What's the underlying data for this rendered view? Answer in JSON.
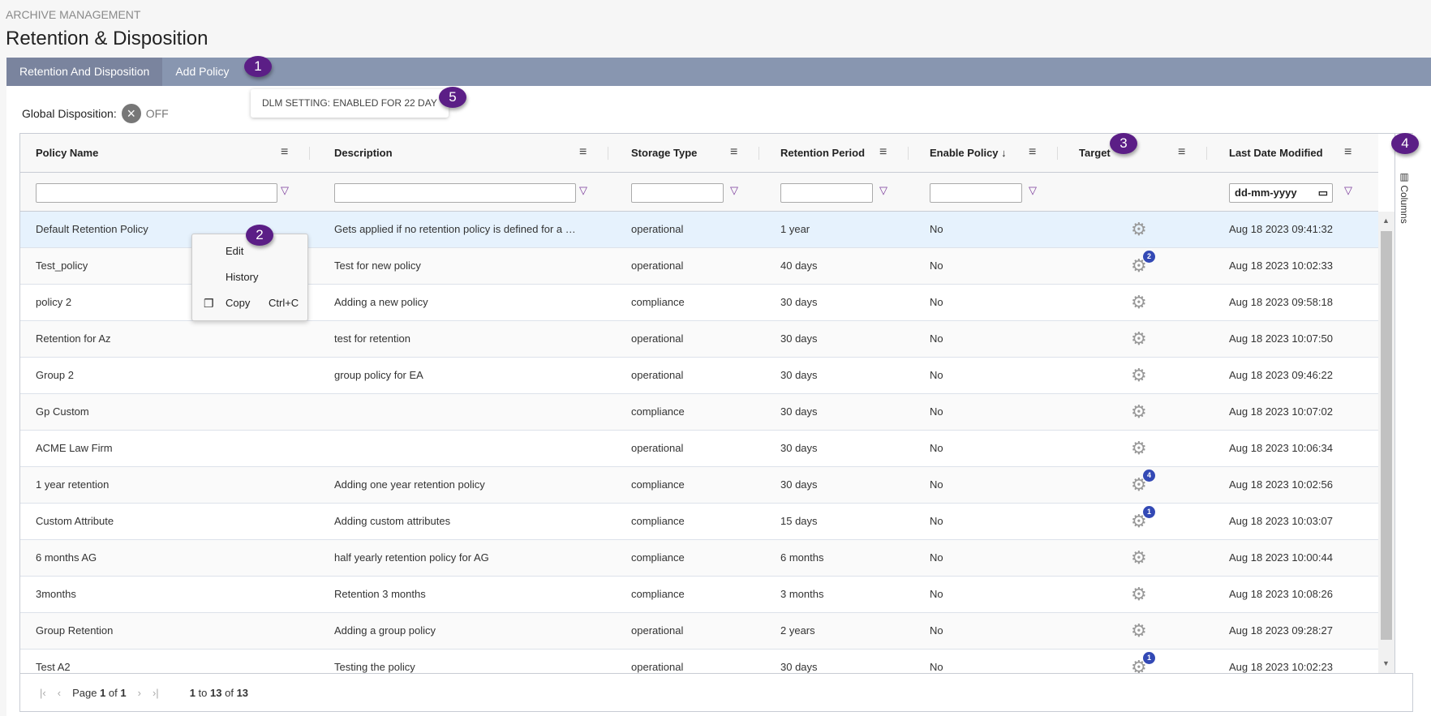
{
  "breadcrumb": "ARCHIVE MANAGEMENT",
  "page_title": "Retention & Disposition",
  "tabs": [
    {
      "label": "Retention And Disposition",
      "active": true
    },
    {
      "label": "Add Policy",
      "active": false
    }
  ],
  "annotations": [
    "1",
    "2",
    "3",
    "4",
    "5"
  ],
  "global_disposition": {
    "label": "Global Disposition:",
    "state": "OFF",
    "icon": "x-circle-icon"
  },
  "dlm_setting": "DLM SETTING: ENABLED FOR 22 DAY",
  "columns": [
    "Policy Name",
    "Description",
    "Storage Type",
    "Retention Period",
    "Enable Policy",
    "Target",
    "Last Date Modified"
  ],
  "sort": {
    "column": "Enable Policy",
    "direction": "descending"
  },
  "date_filter_placeholder": "dd-mm-yyyy",
  "side_panel": {
    "label": "Columns"
  },
  "rows": [
    {
      "name": "Default Retention Policy",
      "description": "Gets applied if no retention policy is defined for a ta...",
      "storage": "operational",
      "period": "1 year",
      "enabled": "No",
      "target_count": "",
      "modified": "Aug 18 2023 09:41:32"
    },
    {
      "name": "Test_policy",
      "description": "Test for new policy",
      "storage": "operational",
      "period": "40 days",
      "enabled": "No",
      "target_count": "2",
      "modified": "Aug 18 2023 10:02:33"
    },
    {
      "name": "policy 2",
      "description": "Adding a new policy",
      "storage": "compliance",
      "period": "30 days",
      "enabled": "No",
      "target_count": "",
      "modified": "Aug 18 2023 09:58:18"
    },
    {
      "name": "Retention for Az",
      "description": "test for retention",
      "storage": "operational",
      "period": "30 days",
      "enabled": "No",
      "target_count": "",
      "modified": "Aug 18 2023 10:07:50"
    },
    {
      "name": "Group 2",
      "description": "group policy for EA",
      "storage": "operational",
      "period": "30 days",
      "enabled": "No",
      "target_count": "",
      "modified": "Aug 18 2023 09:46:22"
    },
    {
      "name": "Gp Custom",
      "description": "",
      "storage": "compliance",
      "period": "30 days",
      "enabled": "No",
      "target_count": "",
      "modified": "Aug 18 2023 10:07:02"
    },
    {
      "name": "ACME Law Firm",
      "description": "",
      "storage": "operational",
      "period": "30 days",
      "enabled": "No",
      "target_count": "",
      "modified": "Aug 18 2023 10:06:34"
    },
    {
      "name": "1 year retention",
      "description": "Adding one year retention policy",
      "storage": "compliance",
      "period": "30 days",
      "enabled": "No",
      "target_count": "4",
      "modified": "Aug 18 2023 10:02:56"
    },
    {
      "name": "Custom Attribute",
      "description": "Adding custom attributes",
      "storage": "compliance",
      "period": "15 days",
      "enabled": "No",
      "target_count": "1",
      "modified": "Aug 18 2023 10:03:07"
    },
    {
      "name": "6 months AG",
      "description": "half yearly retention policy for AG",
      "storage": "compliance",
      "period": "6 months",
      "enabled": "No",
      "target_count": "",
      "modified": "Aug 18 2023 10:00:44"
    },
    {
      "name": "3months",
      "description": "Retention 3 months",
      "storage": "compliance",
      "period": "3 months",
      "enabled": "No",
      "target_count": "",
      "modified": "Aug 18 2023 10:08:26"
    },
    {
      "name": "Group Retention",
      "description": "Adding a group policy",
      "storage": "operational",
      "period": "2 years",
      "enabled": "No",
      "target_count": "",
      "modified": "Aug 18 2023 09:28:27"
    },
    {
      "name": "Test A2",
      "description": "Testing the policy",
      "storage": "operational",
      "period": "30 days",
      "enabled": "No",
      "target_count": "1",
      "modified": "Aug 18 2023 10:02:23"
    }
  ],
  "context_menu": [
    {
      "label": "Edit",
      "shortcut": ""
    },
    {
      "label": "History",
      "shortcut": ""
    },
    {
      "label": "Copy",
      "shortcut": "Ctrl+C",
      "icon": "copy-icon"
    }
  ],
  "pagination": {
    "page_label": "Page",
    "page": "1",
    "of": "of",
    "total_pages": "1",
    "from": "1",
    "to_word": "to",
    "to": "13",
    "of2": "of",
    "total": "13"
  },
  "colors": {
    "tab_bar": "#8896b0",
    "tab_active": "#7a849e",
    "badge": "#5b1e86",
    "count_badge": "#3349b5",
    "selected_row": "#e6f2fd"
  }
}
